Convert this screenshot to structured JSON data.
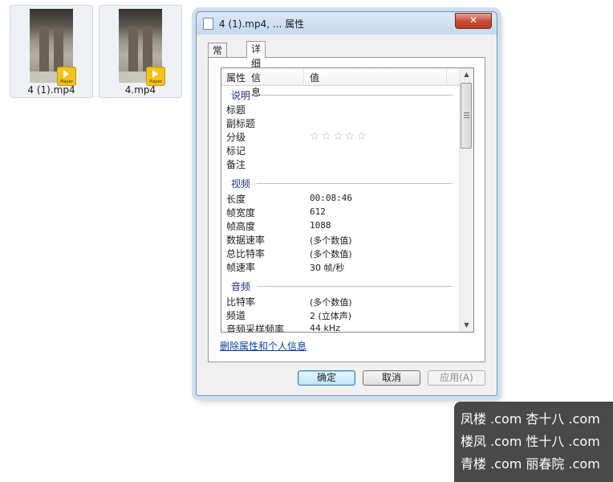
{
  "desktop": {
    "files": [
      {
        "name": "4 (1).mp4",
        "badge": "Player"
      },
      {
        "name": "4.mp4",
        "badge": "Player"
      }
    ]
  },
  "dialog": {
    "title": "4 (1).mp4, ... 属性",
    "close_label": "✕",
    "tabs": [
      {
        "label": "常规",
        "active": false
      },
      {
        "label": "详细信息",
        "active": true
      }
    ],
    "columns": {
      "property": "属性",
      "value": "值"
    },
    "groups": {
      "description": {
        "title": "说明",
        "rows": [
          {
            "name": "标题",
            "value": ""
          },
          {
            "name": "副标题",
            "value": ""
          },
          {
            "name": "分级",
            "value": "",
            "stars": 0
          },
          {
            "name": "标记",
            "value": ""
          },
          {
            "name": "备注",
            "value": ""
          }
        ]
      },
      "video": {
        "title": "视频",
        "rows": [
          {
            "name": "长度",
            "value": "00:08:46"
          },
          {
            "name": "帧宽度",
            "value": "612"
          },
          {
            "name": "帧高度",
            "value": "1088"
          },
          {
            "name": "数据速率",
            "value": "(多个数值)"
          },
          {
            "name": "总比特率",
            "value": "(多个数值)"
          },
          {
            "name": "帧速率",
            "value": "30 帧/秒"
          }
        ]
      },
      "audio": {
        "title": "音频",
        "rows": [
          {
            "name": "比特率",
            "value": "(多个数值)"
          },
          {
            "name": "频道",
            "value": "2 (立体声)"
          },
          {
            "name": "音频采样频率",
            "value": "44 kHz"
          }
        ]
      }
    },
    "star_glyphs": "☆☆☆☆☆",
    "remove_link": "删除属性和个人信息",
    "buttons": {
      "ok": "确定",
      "cancel": "取消",
      "apply": "应用(A)"
    }
  },
  "watermark": {
    "lines": [
      "凤楼 .com  杏十八 .com",
      "楼凤 .com  性十八 .com",
      "青楼 .com  丽春院 .com"
    ]
  },
  "colors": {
    "group_title": "#1e3287",
    "link": "#0f3f9c",
    "close_button": "#c74a32"
  }
}
